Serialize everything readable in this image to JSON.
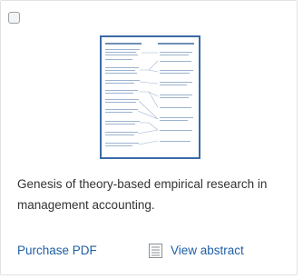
{
  "item": {
    "title": "Genesis of theory-based empirical research in management accounting.",
    "purchase_label": "Purchase PDF",
    "view_abstract_label": "View abstract",
    "checkbox_checked": false
  },
  "icons": {
    "thumbnail": "article-thumbnail-image",
    "view_abstract": "document-lines-icon"
  },
  "colors": {
    "link": "#1f5fa5",
    "text": "#333333",
    "thumbnail_border": "#3a6aa6"
  }
}
